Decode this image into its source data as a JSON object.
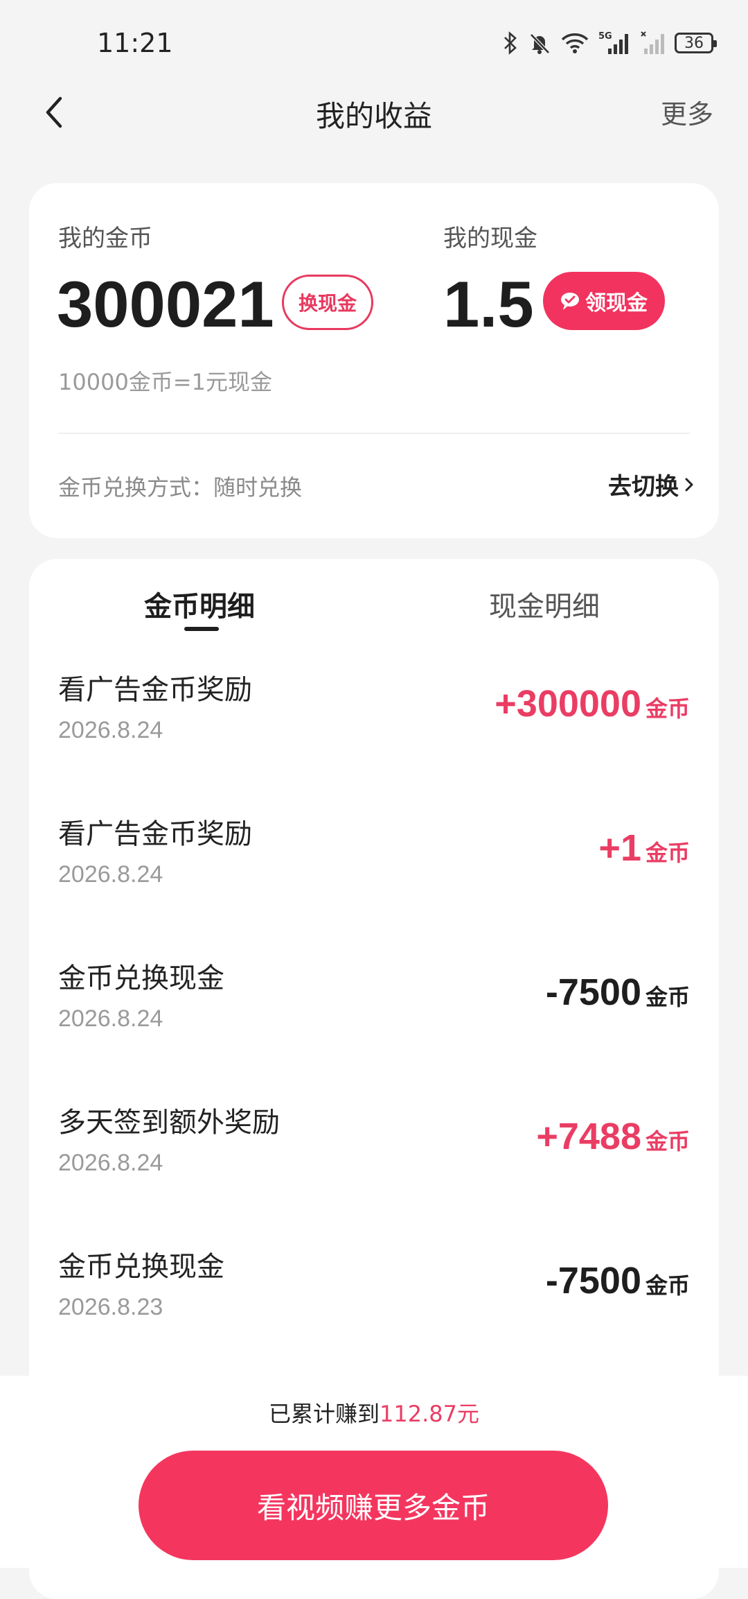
{
  "status_bar": {
    "time": "11:21",
    "battery": "36",
    "network": "5G",
    "icons": [
      "bluetooth-icon",
      "bell-off-icon",
      "wifi-icon",
      "signal-icon",
      "signal-no-service-icon",
      "battery-icon"
    ]
  },
  "nav": {
    "back_icon": "chevron-left-icon",
    "title": "我的收益",
    "more": "更多"
  },
  "balance": {
    "coins_label": "我的金币",
    "coins_value": "300021",
    "exchange_button": "换现金",
    "cash_label": "我的现金",
    "cash_value": "1.5",
    "withdraw_button": "领现金",
    "withdraw_icon": "wechat-icon",
    "rate_text": "10000金币=1元现金",
    "method_text": "金币兑换方式：随时兑换",
    "switch_link": "去切换"
  },
  "details": {
    "tabs": [
      {
        "label": "金币明细",
        "active": true
      },
      {
        "label": "现金明细",
        "active": false
      }
    ],
    "records": [
      {
        "title": "看广告金币奖励",
        "date": "2026.8.24",
        "amount": "+300000",
        "unit": "金币",
        "positive": true
      },
      {
        "title": "看广告金币奖励",
        "date": "2026.8.24",
        "amount": "+1",
        "unit": "金币",
        "positive": true
      },
      {
        "title": "金币兑换现金",
        "date": "2026.8.24",
        "amount": "-7500",
        "unit": "金币",
        "positive": false
      },
      {
        "title": "多天签到额外奖励",
        "date": "2026.8.24",
        "amount": "+7488",
        "unit": "金币",
        "positive": true
      },
      {
        "title": "金币兑换现金",
        "date": "2026.8.23",
        "amount": "-7500",
        "unit": "金币",
        "positive": false
      }
    ]
  },
  "footer": {
    "earned_prefix": "已累计赚到",
    "earned_amount": "112.87元",
    "cta": "看视频赚更多金币"
  },
  "colors": {
    "accent": "#f2335f",
    "positive_amount": "#ea3d64",
    "background": "#f4f4f4"
  }
}
